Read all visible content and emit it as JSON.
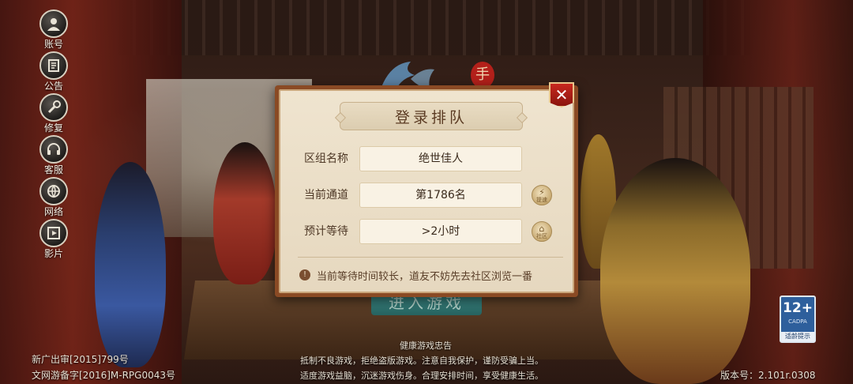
{
  "side_menu": [
    {
      "label": "账号",
      "icon": "account-icon"
    },
    {
      "label": "公告",
      "icon": "announcement-icon"
    },
    {
      "label": "修复",
      "icon": "repair-icon"
    },
    {
      "label": "客服",
      "icon": "customer-service-icon"
    },
    {
      "label": "网络",
      "icon": "network-icon"
    },
    {
      "label": "影片",
      "icon": "video-icon"
    }
  ],
  "background": {
    "logo_char": "手",
    "enter_button": "进入游戏"
  },
  "dialog": {
    "title": "登录排队",
    "rows": [
      {
        "label": "区组名称",
        "value": "绝世佳人"
      },
      {
        "label": "当前通道",
        "value": "第1786名",
        "button": "提速",
        "button_icon": "lightning-icon"
      },
      {
        "label": "预计等待",
        "value": ">2小时",
        "button": "社区",
        "button_icon": "home-icon"
      }
    ],
    "notice": "当前等待时间较长，道友不妨先去社区浏览一番"
  },
  "age_rating": {
    "number": "12+",
    "org": "CADPA",
    "tip": "适龄提示"
  },
  "footer": {
    "license_1": "新广出审[2015]799号",
    "license_2": "文网游备字[2016]M-RPG0043号",
    "health_title": "健康游戏忠告",
    "health_line_1": "抵制不良游戏，拒绝盗版游戏。注意自我保护，谨防受骗上当。",
    "health_line_2": "适度游戏益脑，沉迷游戏伤身。合理安排时间，享受健康生活。",
    "version": "版本号：2.101r.0308"
  },
  "colors": {
    "dialog_border": "#8a4a24",
    "dialog_bg": "#efe4cf",
    "close_red": "#c8281e",
    "age_blue": "#2e5f9c"
  }
}
